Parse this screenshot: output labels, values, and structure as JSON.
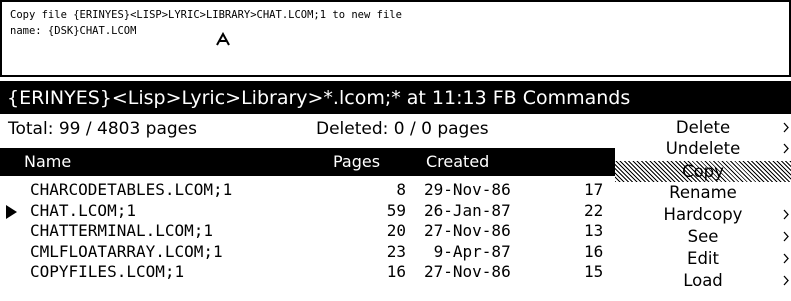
{
  "prompt": {
    "line1": "Copy file {ERINYES}<LISP>LYRIC>LIBRARY>CHAT.LCOM;1 to new file",
    "line2": "name: {DSK}CHAT.LCOM"
  },
  "title_bar": {
    "title": "{ERINYES}<Lisp>Lyric>Library>*.lcom;* at 11:13 FB Commands"
  },
  "summary": {
    "total": "Total: 99 / 4803 pages",
    "deleted": "Deleted: 0 / 0 pages"
  },
  "columns": {
    "name": "Name",
    "pages": "Pages",
    "created": "Created"
  },
  "files": [
    {
      "name": "CHARCODETABLES.LCOM;1",
      "pages": "8",
      "created": "29-Nov-86",
      "time": "17"
    },
    {
      "name": "CHAT.LCOM;1",
      "pages": "59",
      "created": "26-Jan-87",
      "time": "22"
    },
    {
      "name": "CHATTERMINAL.LCOM;1",
      "pages": "20",
      "created": "27-Nov-86",
      "time": "13"
    },
    {
      "name": "CMLFLOATARRAY.LCOM;1",
      "pages": "23",
      "created": " 9-Apr-87",
      "time": "16"
    },
    {
      "name": "COPYFILES.LCOM;1",
      "pages": "16",
      "created": "27-Nov-86",
      "time": "15"
    }
  ],
  "selected_file_index": 1,
  "menu": {
    "items": [
      {
        "label": "Delete",
        "submenu": true
      },
      {
        "label": "Undelete",
        "submenu": true
      },
      {
        "label": "Copy",
        "submenu": false,
        "highlighted": true
      },
      {
        "label": "Rename",
        "submenu": false
      },
      {
        "label": "Hardcopy",
        "submenu": true
      },
      {
        "label": "See",
        "submenu": true
      },
      {
        "label": "Edit",
        "submenu": true
      },
      {
        "label": "Load",
        "submenu": true
      }
    ]
  },
  "icons": {
    "cursor": "caret-cursor-icon",
    "row_pointer": "triangle-pointer-icon",
    "submenu": "submenu-arrow-icon"
  }
}
